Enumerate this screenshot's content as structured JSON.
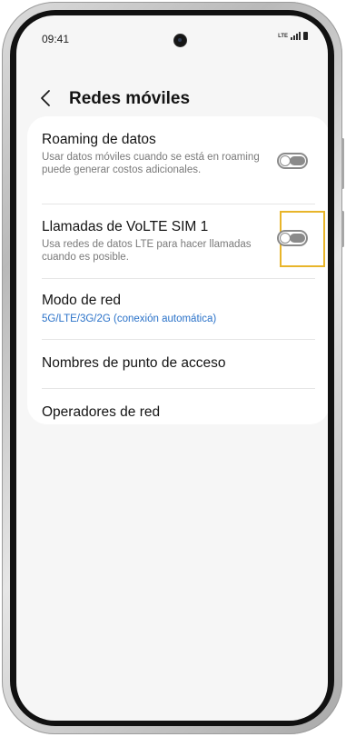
{
  "status_bar": {
    "time": "09:41",
    "network": "LTE"
  },
  "header": {
    "back_icon": "chevron-left-icon",
    "title": "Redes móviles"
  },
  "settings": [
    {
      "id": "data-roaming",
      "title": "Roaming de datos",
      "description": "Usar datos móviles cuando se está en roaming puede generar costos adicionales.",
      "toggle": false
    },
    {
      "id": "volte-sim1",
      "title": "Llamadas de VoLTE SIM 1",
      "description": "Usa redes de datos LTE para hacer llamadas cuando es posible.",
      "toggle": false,
      "highlighted": true
    },
    {
      "id": "network-mode",
      "title": "Modo de red",
      "value": "5G/LTE/3G/2G (conexión automática)"
    },
    {
      "id": "access-point-names",
      "title": "Nombres de punto de acceso"
    },
    {
      "id": "network-operators",
      "title": "Operadores de red"
    }
  ],
  "colors": {
    "accent_link": "#2a72c9",
    "highlight": "#e8b52a",
    "toggle_off": "#8a8a8a"
  }
}
